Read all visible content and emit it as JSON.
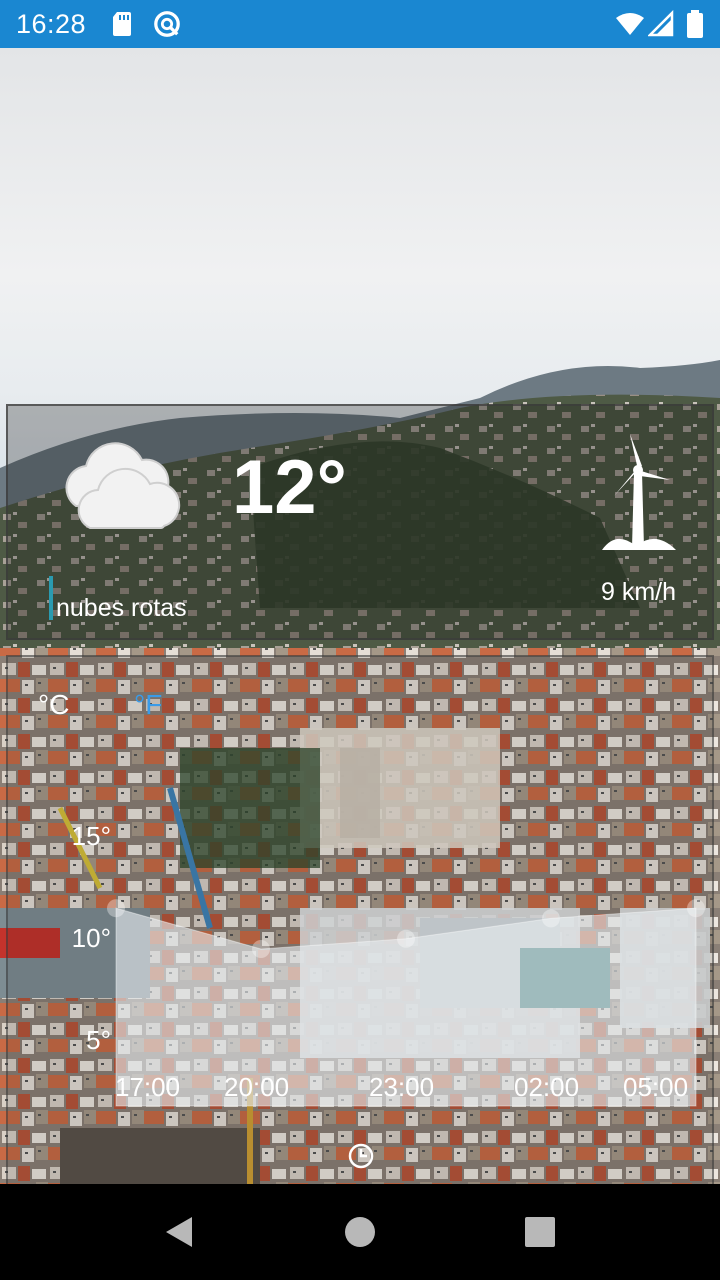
{
  "status_bar": {
    "time": "16:28",
    "icons": [
      "sd-card-icon",
      "sync-icon",
      "wifi-icon",
      "signal-icon",
      "battery-icon"
    ]
  },
  "current": {
    "temperature": "12°",
    "condition": "nubes rotas",
    "wind": "9 km/h",
    "icons": {
      "weather": "broken-clouds-icon",
      "wind": "wind-turbine-icon"
    }
  },
  "forecast": {
    "units": {
      "celsius": "°C",
      "fahrenheit": "°F",
      "selected": "celsius"
    },
    "y_ticks": [
      "15°",
      "10°",
      "5°"
    ],
    "x_ticks": [
      "17:00",
      "20:00",
      "23:00",
      "02:00",
      "05:00"
    ]
  },
  "chart_data": {
    "type": "area",
    "x": [
      "17:00",
      "20:00",
      "23:00",
      "02:00",
      "05:00"
    ],
    "series": [
      {
        "values": [
          12,
          10,
          10.5,
          11.5,
          12
        ]
      }
    ],
    "ylim": [
      5,
      15
    ],
    "y_ticks": [
      5,
      10,
      15
    ]
  },
  "colors": {
    "status_bar": "#1a87d1",
    "unit_selected": "#ffffff",
    "unit_unselected": "#3a9be8",
    "chart_fill": "#e6ebef"
  },
  "nav": [
    "back-icon",
    "home-icon",
    "recents-icon"
  ]
}
